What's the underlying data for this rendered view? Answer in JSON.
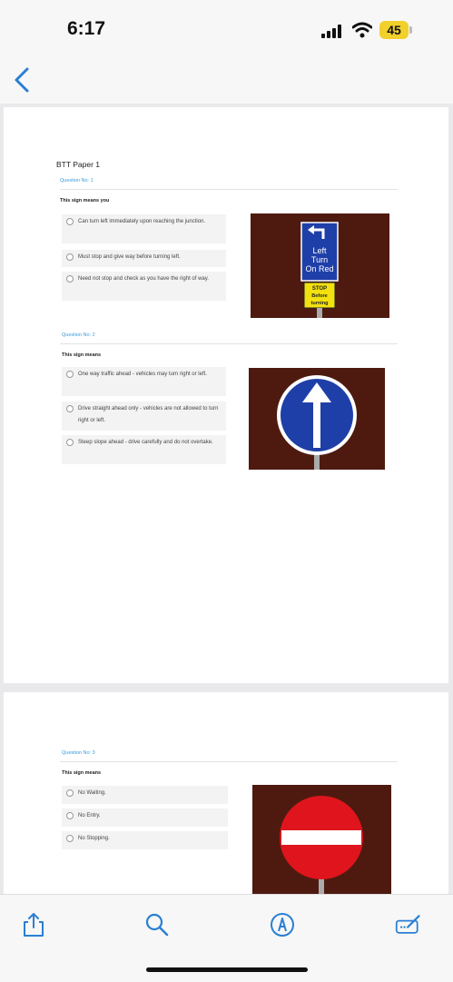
{
  "status": {
    "time": "6:17",
    "battery": "45"
  },
  "nav": {
    "back_icon": "chevron-left-icon"
  },
  "doc": {
    "title": "BTT Paper 1",
    "questions": [
      {
        "number": "Question No: 1",
        "text": "This sign means you",
        "options": [
          "Can turn left immediately upon reaching the junction.",
          "Must stop and give way before turning left.",
          "Need not stop and check as you have the right of way."
        ],
        "sign": {
          "lines": [
            "Left",
            "Turn",
            "On Red"
          ],
          "plate_lines": [
            "STOP",
            "Before",
            "turning"
          ]
        }
      },
      {
        "number": "Question No: 2",
        "text": "This sign means",
        "options": [
          "One way traffic ahead - vehicles may turn right or left.",
          "Drive straight ahead only - vehicles are not allowed to turn right or left.",
          "Steep slope ahead - drive carefully and do not overtake."
        ]
      },
      {
        "number": "Question No: 3",
        "text": "This sign means",
        "options": [
          "No Waiting.",
          "No Entry.",
          "No Stopping."
        ]
      }
    ]
  },
  "toolbar": {
    "icons": [
      "share-icon",
      "search-icon",
      "markup-icon",
      "edit-icon"
    ]
  },
  "colors": {
    "accent": "#3a9ad9",
    "sign_background": "#4e1a10",
    "sign_blue": "#1f3fa8",
    "sign_red": "#e0141c"
  }
}
